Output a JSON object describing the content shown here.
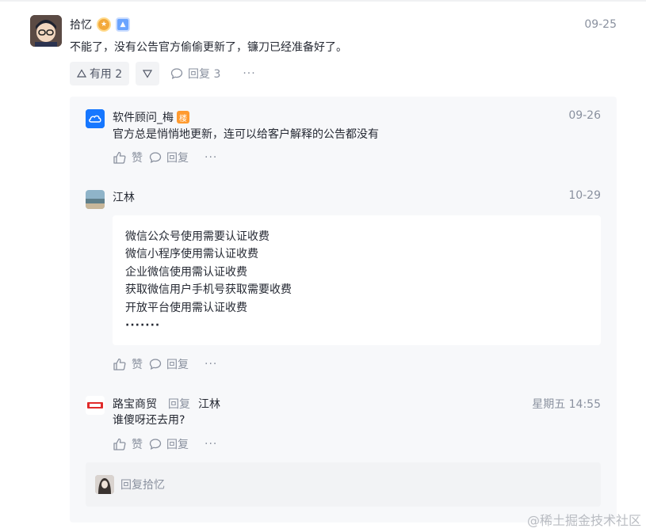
{
  "main_comment": {
    "username": "拾忆",
    "time": "09-25",
    "text": "不能了，没有公告官方偷偷更新了，镰刀已经准备好了。",
    "like_label": "有用 2",
    "reply_label": "回复 3",
    "more": "···"
  },
  "replies": [
    {
      "username": "软件顾问_梅",
      "author_badge": "楼",
      "time": "09-26",
      "text": "官方总是悄悄地更新，连可以给客户解释的公告都没有",
      "like_label": "赞",
      "reply_label": "回复",
      "more": "···"
    },
    {
      "username": "江林",
      "time": "10-29",
      "lines": [
        "微信公众号使用需要认证收费",
        "微信小程序使用需认证收费",
        "企业微信使用需认证收费",
        "获取微信用户手机号获取需要收费",
        "开放平台使用需认证收费",
        "·······"
      ],
      "like_label": "赞",
      "reply_label": "回复",
      "more": "···"
    },
    {
      "username": "路宝商贸",
      "reply_word": "回复",
      "reply_target": "江林",
      "time": "星期五 14:55",
      "text": "谁傻呀还去用?",
      "like_label": "赞",
      "reply_label": "回复",
      "more": "···"
    }
  ],
  "reply_input": {
    "placeholder": "回复拾忆"
  },
  "watermark": "@稀土掘金技术社区",
  "colors": {
    "text": "#252933",
    "muted": "#8a919f",
    "panel_bg": "#f7f8fa",
    "button_bg": "#f2f3f5"
  }
}
